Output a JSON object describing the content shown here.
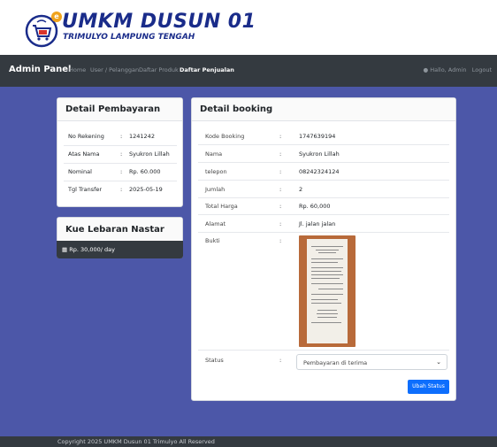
{
  "brand_header": {
    "logo_title": "UMKM DUSUN 01",
    "logo_subtitle": "TRIMULYO LAMPUNG TENGAH",
    "logo_badge": "e"
  },
  "navbar": {
    "brand": "Admin Panel",
    "items": [
      {
        "label": "Home",
        "active": false
      },
      {
        "label": "User / Pelanggan",
        "active": false
      },
      {
        "label": "Daftar Produk",
        "active": false
      },
      {
        "label": "Daftar Penjualan",
        "active": true
      }
    ],
    "greeting": "Hallo, Admin",
    "logout": "Logout"
  },
  "payment": {
    "title": "Detail Pembayaran",
    "rows": [
      {
        "label": "No Rekening",
        "value": "1241242"
      },
      {
        "label": "Atas Nama",
        "value": "Syukron Lillah"
      },
      {
        "label": "Nominal",
        "value": "Rp. 60.000"
      },
      {
        "label": "Tgl Transfer",
        "value": "2025-05-19"
      }
    ]
  },
  "product": {
    "title": "Kue Lebaran Nastar",
    "price": "Rp. 30,000/ day"
  },
  "booking": {
    "title": "Detail booking",
    "rows": [
      {
        "label": "Kode Booking",
        "value": "1747639194"
      },
      {
        "label": "Nama",
        "value": "Syukron Lillah"
      },
      {
        "label": "telepon",
        "value": "08242324124"
      },
      {
        "label": "Jumlah",
        "value": "2"
      },
      {
        "label": "Total Harga",
        "value": "Rp. 60,000"
      },
      {
        "label": "Alamat",
        "value": "Jl. jalan jalan"
      }
    ],
    "bukti_label": "Bukti",
    "status_label": "Status",
    "status_value": "Pembayaran di terima",
    "button_label": "Ubah Status",
    "separator": ":"
  },
  "footer": {
    "text": "Copyright 2025 UMKM Dusun 01 Trimulyo All Reserved"
  },
  "colors": {
    "primary_blue": "#0d6efd",
    "navbar_dark": "#343a40",
    "background_blue": "#4c57a8",
    "logo_blue": "#1a2c8a"
  }
}
